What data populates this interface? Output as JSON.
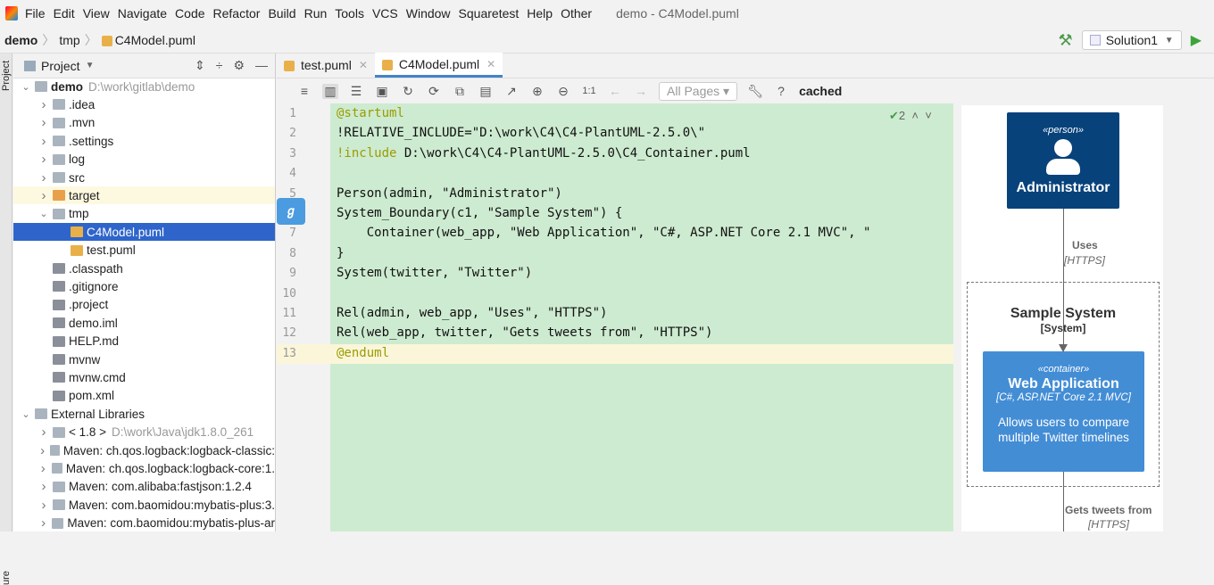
{
  "menu": {
    "items": [
      "File",
      "Edit",
      "View",
      "Navigate",
      "Code",
      "Refactor",
      "Build",
      "Run",
      "Tools",
      "VCS",
      "Window",
      "Squaretest",
      "Help",
      "Other"
    ],
    "title": "demo - C4Model.puml"
  },
  "breadcrumb": [
    "demo",
    "tmp",
    "C4Model.puml"
  ],
  "run_config": "Solution1",
  "stripe": {
    "top": "Project",
    "bottom": "ure"
  },
  "project_panel": {
    "title": "Project",
    "rows": [
      {
        "label": "demo",
        "path": "D:\\work\\gitlab\\demo",
        "level": 0,
        "expand": "open",
        "bold": true
      },
      {
        "label": ".idea",
        "level": 1,
        "expand": "closed"
      },
      {
        "label": ".mvn",
        "level": 1,
        "expand": "closed"
      },
      {
        "label": ".settings",
        "level": 1,
        "expand": "closed"
      },
      {
        "label": "log",
        "level": 1,
        "expand": "closed"
      },
      {
        "label": "src",
        "level": 1,
        "expand": "closed"
      },
      {
        "label": "target",
        "level": 1,
        "expand": "closed",
        "highlight": true
      },
      {
        "label": "tmp",
        "level": 1,
        "expand": "open"
      },
      {
        "label": "C4Model.puml",
        "level": 2,
        "selected": true
      },
      {
        "label": "test.puml",
        "level": 2
      },
      {
        "label": ".classpath",
        "level": 1
      },
      {
        "label": ".gitignore",
        "level": 1
      },
      {
        "label": ".project",
        "level": 1
      },
      {
        "label": "demo.iml",
        "level": 1
      },
      {
        "label": "HELP.md",
        "level": 1
      },
      {
        "label": "mvnw",
        "level": 1
      },
      {
        "label": "mvnw.cmd",
        "level": 1
      },
      {
        "label": "pom.xml",
        "level": 1
      },
      {
        "label": "External Libraries",
        "level": 0,
        "expand": "open"
      },
      {
        "label": "< 1.8 >",
        "path": "D:\\work\\Java\\jdk1.8.0_261",
        "level": 1,
        "expand": "closed"
      },
      {
        "label": "Maven: ch.qos.logback:logback-classic:",
        "level": 1,
        "expand": "closed"
      },
      {
        "label": "Maven: ch.qos.logback:logback-core:1.",
        "level": 1,
        "expand": "closed"
      },
      {
        "label": "Maven: com.alibaba:fastjson:1.2.4",
        "level": 1,
        "expand": "closed"
      },
      {
        "label": "Maven: com.baomidou:mybatis-plus:3.",
        "level": 1,
        "expand": "closed"
      },
      {
        "label": "Maven: com.baomidou:mybatis-plus-ar",
        "level": 1,
        "expand": "closed"
      }
    ]
  },
  "tabs": [
    {
      "label": "test.puml",
      "active": false
    },
    {
      "label": "C4Model.puml",
      "active": true
    }
  ],
  "editor_toolbar": {
    "pages": "All Pages",
    "help": "?",
    "status": "cached"
  },
  "inspection": "2",
  "code": [
    "@startuml",
    "!RELATIVE_INCLUDE=\"D:\\work\\C4\\C4-PlantUML-2.5.0\\\"",
    "!include D:\\work\\C4\\C4-PlantUML-2.5.0\\C4_Container.puml",
    "",
    "Person(admin, \"Administrator\")",
    "System_Boundary(c1, \"Sample System\") {",
    "    Container(web_app, \"Web Application\", \"C#, ASP.NET Core 2.1 MVC\", \"",
    "}",
    "System(twitter, \"Twitter\")",
    "",
    "Rel(admin, web_app, \"Uses\", \"HTTPS\")",
    "Rel(web_app, twitter, \"Gets tweets from\", \"HTTPS\")",
    "@enduml"
  ],
  "diagram": {
    "person": {
      "stereotype": "«person»",
      "name": "Administrator",
      "color": "#08427b"
    },
    "rel1": {
      "label": "Uses",
      "tech": "[HTTPS]"
    },
    "boundary": {
      "name": "Sample System",
      "type": "[System]"
    },
    "container": {
      "stereotype": "«container»",
      "name": "Web Application",
      "tech": "[C#, ASP.NET Core 2.1 MVC]",
      "desc1": "Allows users to compare",
      "desc2": "multiple Twitter timelines",
      "color": "#438dd5"
    },
    "rel2": {
      "label": "Gets tweets from",
      "tech": "[HTTPS]"
    }
  }
}
